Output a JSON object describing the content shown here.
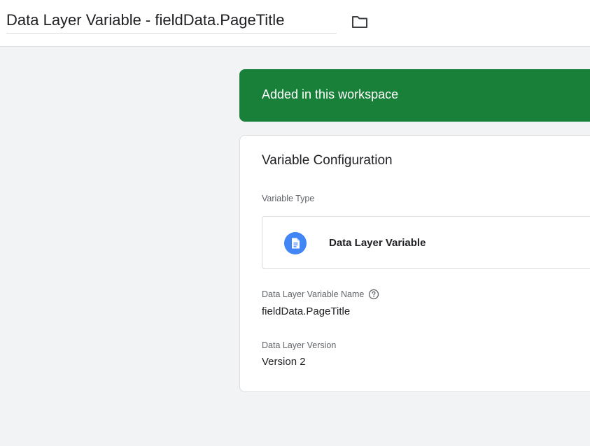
{
  "header": {
    "title": "Data Layer Variable - fieldData.PageTitle",
    "folder_icon": "folder-icon"
  },
  "banner": {
    "text": "Added in this workspace",
    "color": "#188038"
  },
  "card": {
    "title": "Variable Configuration",
    "variable_type": {
      "label": "Variable Type",
      "value": "Data Layer Variable",
      "icon": "document-icon",
      "icon_color": "#4285f4"
    },
    "variable_name": {
      "label": "Data Layer Variable Name",
      "help_icon": "help-icon",
      "value": "fieldData.PageTitle"
    },
    "version": {
      "label": "Data Layer Version",
      "value": "Version 2"
    }
  }
}
